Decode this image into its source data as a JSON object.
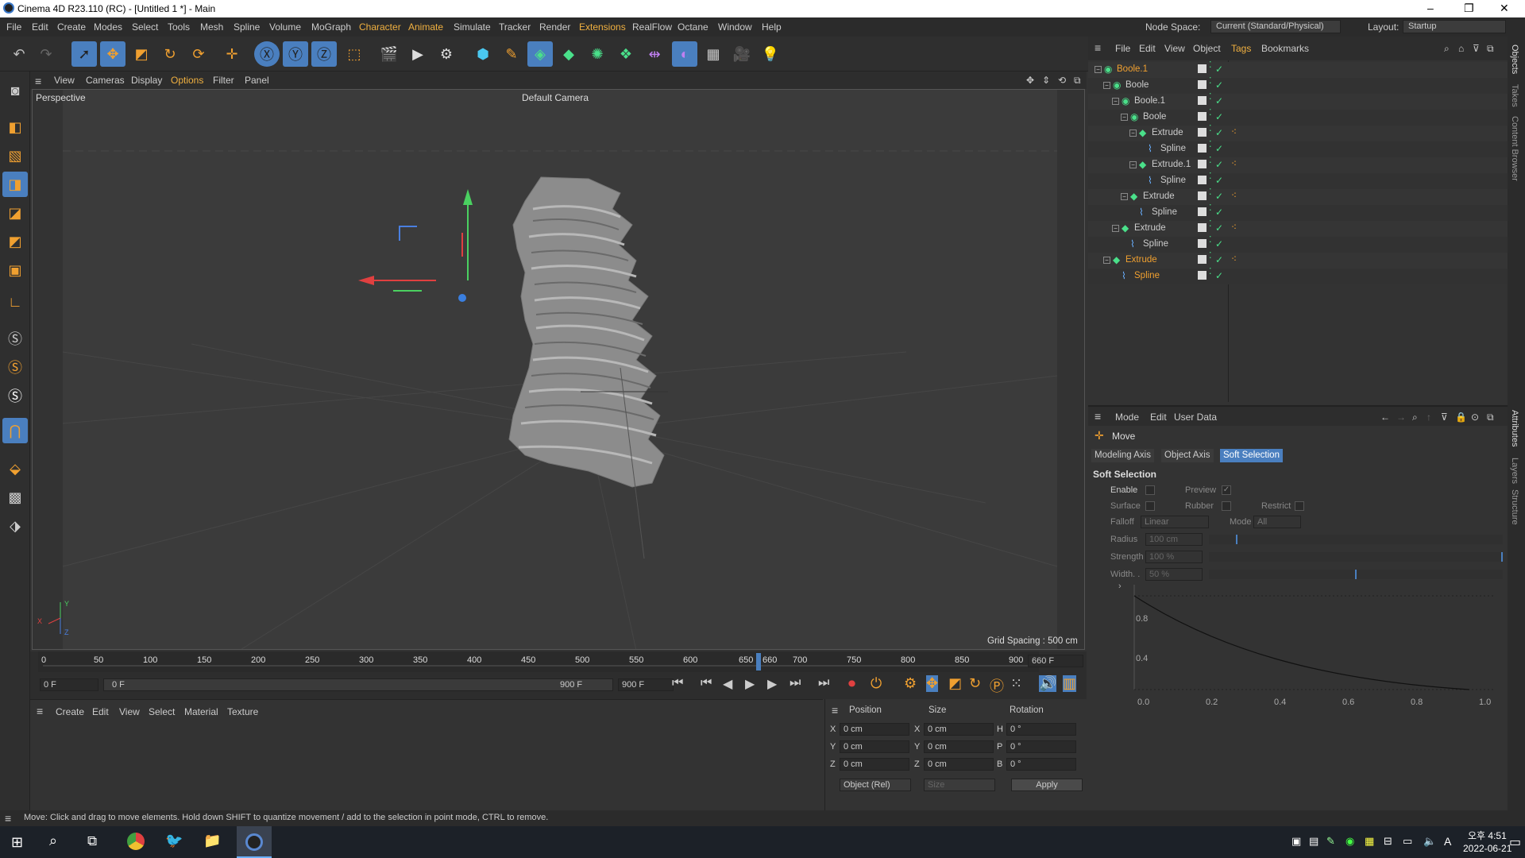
{
  "window": {
    "title": "Cinema 4D R23.110 (RC) - [Untitled 1 *] - Main",
    "controls": [
      "–",
      "❐",
      "✕"
    ]
  },
  "menubar": {
    "items": [
      "File",
      "Edit",
      "Create",
      "Modes",
      "Select",
      "Tools",
      "Mesh",
      "Spline",
      "Volume",
      "MoGraph",
      "Character",
      "Animate",
      "Simulate",
      "Tracker",
      "Render",
      "Extensions",
      "RealFlow",
      "Octane",
      "Window",
      "Help"
    ],
    "node_space_label": "Node Space:",
    "node_space_value": "Current (Standard/Physical)",
    "layout_label": "Layout:",
    "layout_value": "Startup"
  },
  "viewport": {
    "menu": [
      "View",
      "Cameras",
      "Display",
      "Options",
      "Filter",
      "Panel"
    ],
    "name": "Perspective",
    "camera": "Default Camera",
    "grid_spacing": "Grid Spacing : 500 cm",
    "axis_x": "X",
    "axis_y": "Y",
    "axis_z": "Z"
  },
  "timeline": {
    "ticks": [
      "0",
      "50",
      "100",
      "150",
      "200",
      "250",
      "300",
      "350",
      "400",
      "450",
      "500",
      "550",
      "600",
      "650",
      "660",
      "700",
      "750",
      "800",
      "850",
      "900"
    ],
    "current_frame": "660 F",
    "start_field": "0 F",
    "range_start": "0 F",
    "range_end": "900 F",
    "end_field": "900 F"
  },
  "material": {
    "menu": [
      "Create",
      "Edit",
      "View",
      "Select",
      "Material",
      "Texture"
    ]
  },
  "coords": {
    "headers": [
      "Position",
      "Size",
      "Rotation"
    ],
    "rows": [
      {
        "axis": "X",
        "pos": "0 cm",
        "saxis": "X",
        "size": "0 cm",
        "raxis": "H",
        "rot": "0 °"
      },
      {
        "axis": "Y",
        "pos": "0 cm",
        "saxis": "Y",
        "size": "0 cm",
        "raxis": "P",
        "rot": "0 °"
      },
      {
        "axis": "Z",
        "pos": "0 cm",
        "saxis": "Z",
        "size": "0 cm",
        "raxis": "B",
        "rot": "0 °"
      }
    ],
    "mode": "Object (Rel)",
    "size_mode": "Size",
    "apply": "Apply"
  },
  "status": "Move: Click and drag to move elements. Hold down SHIFT to quantize movement / add to the selection in point mode, CTRL to remove.",
  "objects": {
    "menu": [
      "File",
      "Edit",
      "View",
      "Object",
      "Tags",
      "Bookmarks"
    ],
    "tree": [
      {
        "name": "Boole.1",
        "level": 0,
        "hl": true,
        "icon": "boole",
        "tag": false
      },
      {
        "name": "Boole",
        "level": 1,
        "hl": false,
        "icon": "boole",
        "tag": false
      },
      {
        "name": "Boole.1",
        "level": 2,
        "hl": false,
        "icon": "boole",
        "tag": false
      },
      {
        "name": "Boole",
        "level": 3,
        "hl": false,
        "icon": "boole",
        "tag": false
      },
      {
        "name": "Extrude",
        "level": 4,
        "hl": false,
        "icon": "extrude",
        "tag": true
      },
      {
        "name": "Spline",
        "level": 5,
        "hl": false,
        "icon": "spline",
        "tag": false
      },
      {
        "name": "Extrude.1",
        "level": 4,
        "hl": false,
        "icon": "extrude",
        "tag": true
      },
      {
        "name": "Spline",
        "level": 5,
        "hl": false,
        "icon": "spline",
        "tag": false
      },
      {
        "name": "Extrude",
        "level": 3,
        "hl": false,
        "icon": "extrude",
        "tag": true
      },
      {
        "name": "Spline",
        "level": 4,
        "hl": false,
        "icon": "spline",
        "tag": false
      },
      {
        "name": "Extrude",
        "level": 2,
        "hl": false,
        "icon": "extrude",
        "tag": true
      },
      {
        "name": "Spline",
        "level": 3,
        "hl": false,
        "icon": "spline",
        "tag": false
      },
      {
        "name": "Extrude",
        "level": 1,
        "hl": true,
        "icon": "extrude",
        "tag": true
      },
      {
        "name": "Spline",
        "level": 2,
        "hl": true,
        "icon": "spline",
        "tag": false
      }
    ]
  },
  "attributes": {
    "menu": [
      "Mode",
      "Edit",
      "User Data"
    ],
    "tool": "Move",
    "tabs": [
      "Modeling Axis",
      "Object Axis",
      "Soft Selection"
    ],
    "section": "Soft Selection",
    "enable": "Enable",
    "preview": "Preview",
    "surface": "Surface",
    "rubber": "Rubber",
    "restrict": "Restrict",
    "falloff_label": "Falloff",
    "falloff": "Linear",
    "mode_label": "Mode",
    "mode": "All",
    "radius_label": "Radius",
    "radius": "100 cm",
    "strength_label": "Strength",
    "strength": "100 %",
    "width_label": "Width. .",
    "width": "50 %",
    "graph_x": [
      "0.0",
      "0.2",
      "0.4",
      "0.6",
      "0.8",
      "1.0"
    ],
    "graph_y": [
      "0.8",
      "0.4"
    ]
  },
  "right_tabs": [
    "Objects",
    "Takes",
    "Content Browser",
    "Attributes",
    "Layers",
    "Structure"
  ],
  "taskbar": {
    "time": "오후 4:51",
    "date": "2022-06-21",
    "lang": "A"
  }
}
